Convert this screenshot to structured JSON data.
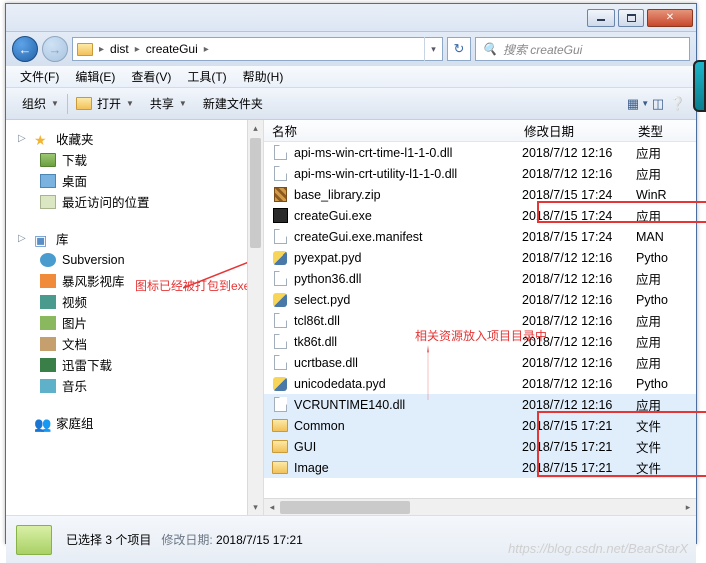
{
  "breadcrumb": {
    "root": "dist",
    "current": "createGui"
  },
  "search": {
    "placeholder": "搜索 createGui"
  },
  "menubar": [
    {
      "key": "file",
      "label": "文件(F)"
    },
    {
      "key": "edit",
      "label": "编辑(E)"
    },
    {
      "key": "view",
      "label": "查看(V)"
    },
    {
      "key": "tools",
      "label": "工具(T)"
    },
    {
      "key": "help",
      "label": "帮助(H)"
    }
  ],
  "toolbar": {
    "organize": "组织",
    "open": "打开",
    "share": "共享",
    "newfolder": "新建文件夹"
  },
  "tree": {
    "favorites": {
      "label": "收藏夹",
      "items": [
        {
          "key": "downloads",
          "label": "下载"
        },
        {
          "key": "desktop",
          "label": "桌面"
        },
        {
          "key": "recent",
          "label": "最近访问的位置"
        }
      ]
    },
    "libraries": {
      "label": "库",
      "items": [
        {
          "key": "subversion",
          "label": "Subversion"
        },
        {
          "key": "baofeng",
          "label": "暴风影视库"
        },
        {
          "key": "videos",
          "label": "视频"
        },
        {
          "key": "pictures",
          "label": "图片"
        },
        {
          "key": "documents",
          "label": "文档"
        },
        {
          "key": "xunlei",
          "label": "迅雷下载"
        },
        {
          "key": "music",
          "label": "音乐"
        }
      ]
    },
    "homegroup": {
      "label": "家庭组"
    }
  },
  "annotations": {
    "icon_packed": "图标已经被打包到exe",
    "resources": "相关资源放入项目目录中"
  },
  "columns": {
    "name": "名称",
    "date": "修改日期",
    "type": "类型"
  },
  "files": [
    {
      "ico": "dll",
      "name": "api-ms-win-crt-time-l1-1-0.dll",
      "date": "2018/7/12 12:16",
      "type": "应用"
    },
    {
      "ico": "dll",
      "name": "api-ms-win-crt-utility-l1-1-0.dll",
      "date": "2018/7/12 12:16",
      "type": "应用"
    },
    {
      "ico": "zip",
      "name": "base_library.zip",
      "date": "2018/7/15 17:24",
      "type": "WinR"
    },
    {
      "ico": "exe",
      "name": "createGui.exe",
      "date": "2018/7/15 17:24",
      "type": "应用"
    },
    {
      "ico": "dll",
      "name": "createGui.exe.manifest",
      "date": "2018/7/15 17:24",
      "type": "MAN"
    },
    {
      "ico": "pyd",
      "name": "pyexpat.pyd",
      "date": "2018/7/12 12:16",
      "type": "Pytho"
    },
    {
      "ico": "dll",
      "name": "python36.dll",
      "date": "2018/7/12 12:16",
      "type": "应用"
    },
    {
      "ico": "pyd",
      "name": "select.pyd",
      "date": "2018/7/12 12:16",
      "type": "Pytho"
    },
    {
      "ico": "dll",
      "name": "tcl86t.dll",
      "date": "2018/7/12 12:16",
      "type": "应用"
    },
    {
      "ico": "dll",
      "name": "tk86t.dll",
      "date": "2018/7/12 12:16",
      "type": "应用"
    },
    {
      "ico": "dll",
      "name": "ucrtbase.dll",
      "date": "2018/7/12 12:16",
      "type": "应用"
    },
    {
      "ico": "pyd",
      "name": "unicodedata.pyd",
      "date": "2018/7/12 12:16",
      "type": "Pytho"
    },
    {
      "ico": "dll",
      "name": "VCRUNTIME140.dll",
      "date": "2018/7/12 12:16",
      "type": "应用",
      "sel": true
    },
    {
      "ico": "fold",
      "name": "Common",
      "date": "2018/7/15 17:21",
      "type": "文件",
      "sel": true
    },
    {
      "ico": "fold",
      "name": "GUI",
      "date": "2018/7/15 17:21",
      "type": "文件",
      "sel": true
    },
    {
      "ico": "fold",
      "name": "Image",
      "date": "2018/7/15 17:21",
      "type": "文件",
      "sel": true
    }
  ],
  "status": {
    "selection": "已选择 3 个项目",
    "mod_label": "修改日期:",
    "mod_value": "2018/7/15 17:21"
  },
  "watermark": "https://blog.csdn.net/BearStarX"
}
